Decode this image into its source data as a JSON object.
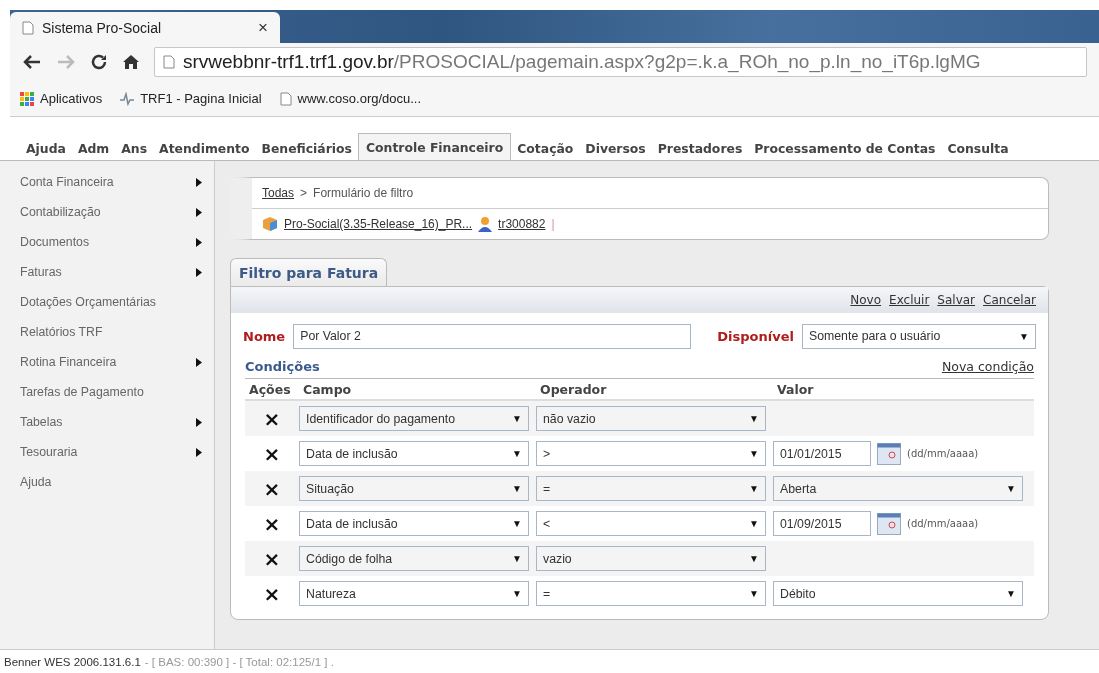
{
  "browser": {
    "tab_title": "Sistema Pro-Social",
    "tab_close": "×",
    "url_host": "srvwebbnr-trf1.trf1.gov.br",
    "url_path": "/PROSOCIAL/pagemain.aspx?g2p=.k.a_ROh_no_p.ln_no_iT6p.lgMG",
    "bookmarks": [
      {
        "kind": "apps",
        "label": "Aplicativos"
      },
      {
        "kind": "site",
        "label": "TRF1 - Pagina Inicial"
      },
      {
        "kind": "page",
        "label": "www.coso.org/docu..."
      }
    ]
  },
  "menu": [
    {
      "label": "Ajuda",
      "selected": false
    },
    {
      "label": "Adm",
      "selected": false
    },
    {
      "label": "Ans",
      "selected": false
    },
    {
      "label": "Atendimento",
      "selected": false
    },
    {
      "label": "Beneficiários",
      "selected": false
    },
    {
      "label": "Controle Financeiro",
      "selected": true
    },
    {
      "label": "Cotação",
      "selected": false
    },
    {
      "label": "Diversos",
      "selected": false
    },
    {
      "label": "Prestadores",
      "selected": false
    },
    {
      "label": "Processamento de Contas",
      "selected": false
    },
    {
      "label": "Consulta",
      "selected": false
    }
  ],
  "sidebar": {
    "items": [
      {
        "label": "Conta Financeira",
        "has_submenu": true
      },
      {
        "label": "Contabilização",
        "has_submenu": true
      },
      {
        "label": "Documentos",
        "has_submenu": true
      },
      {
        "label": "Faturas",
        "has_submenu": true
      },
      {
        "label": "Dotações Orçamentárias",
        "has_submenu": false
      },
      {
        "label": "Relatórios TRF",
        "has_submenu": false
      },
      {
        "label": "Rotina Financeira",
        "has_submenu": true
      },
      {
        "label": "Tarefas de Pagamento",
        "has_submenu": false
      },
      {
        "label": "Tabelas",
        "has_submenu": true
      },
      {
        "label": "Tesouraria",
        "has_submenu": true
      },
      {
        "label": "Ajuda",
        "has_submenu": false
      }
    ]
  },
  "breadcrumb": {
    "root": "Todas",
    "separator": ">",
    "current": "Formulário de filtro",
    "system": "Pro-Social(3.35-Release_16)_PR...",
    "user": "tr300882",
    "divider": "|"
  },
  "form": {
    "tab": "Filtro para Fatura",
    "actions": [
      "Novo",
      "Excluir",
      "Salvar",
      "Cancelar"
    ],
    "name_label": "Nome",
    "name_value": "Por Valor 2",
    "available_label": "Disponível",
    "available_value": "Somente para o usuário",
    "conditions_title": "Condições",
    "new_condition": "Nova condição",
    "columns": [
      "Ações",
      "Campo",
      "Operador",
      "Valor"
    ],
    "delete_mark": "×",
    "dropdown_mark": "▼",
    "rows": [
      {
        "field": "Identificador do pagamento",
        "operator": "não vazio",
        "kind": "none"
      },
      {
        "field": "Data de inclusão",
        "operator": ">",
        "kind": "date",
        "value": "01/01/2015",
        "hint": "(dd/mm/aaaa)"
      },
      {
        "field": "Situação",
        "operator": "=",
        "kind": "select",
        "value": "Aberta"
      },
      {
        "field": "Data de inclusão",
        "operator": "<",
        "kind": "date",
        "value": "01/09/2015",
        "hint": "(dd/mm/aaaa)"
      },
      {
        "field": "Código de folha",
        "operator": "vazio",
        "kind": "none"
      },
      {
        "field": "Natureza",
        "operator": "=",
        "kind": "select",
        "value": "Débito"
      }
    ]
  },
  "status_bar": {
    "version": "Benner WES 2006.131.6.1",
    "timing": "- [ BAS: 00:390 ] - [ Total: 02:125/1 ] ."
  }
}
